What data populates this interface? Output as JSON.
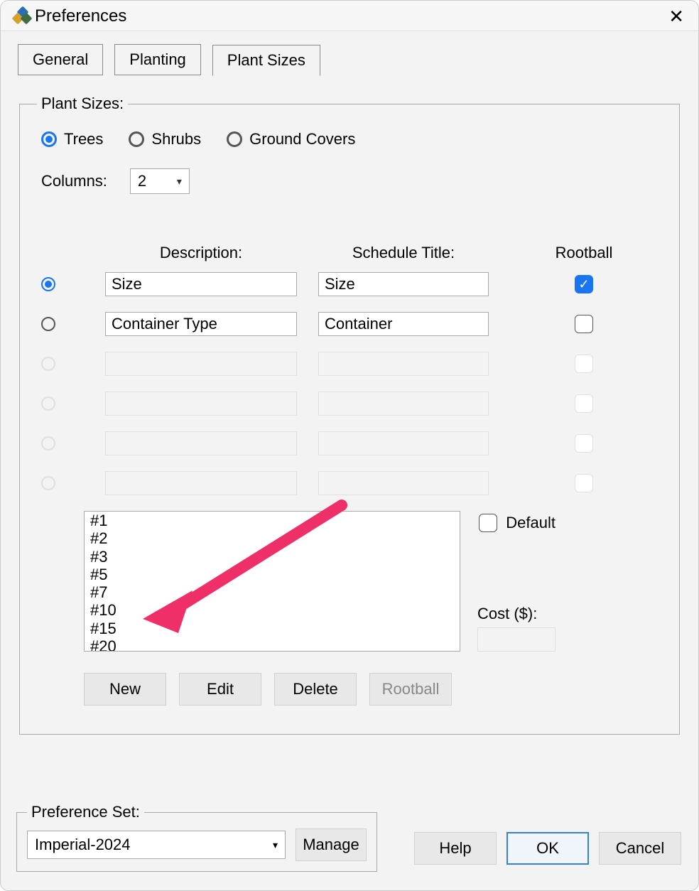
{
  "window": {
    "title": "Preferences"
  },
  "tabs": {
    "general": "General",
    "planting": "Planting",
    "plant_sizes": "Plant Sizes"
  },
  "plant_sizes": {
    "legend": "Plant Sizes:",
    "categories": {
      "trees": "Trees",
      "shrubs": "Shrubs",
      "ground_covers": "Ground Covers"
    },
    "columns_label": "Columns:",
    "columns_value": "2",
    "headers": {
      "description": "Description:",
      "schedule_title": "Schedule Title:",
      "rootball": "Rootball"
    },
    "rows": [
      {
        "description": "Size",
        "schedule": "Size",
        "rootball_checked": true,
        "enabled": true,
        "selected": true
      },
      {
        "description": "Container Type",
        "schedule": "Container",
        "rootball_checked": false,
        "enabled": true,
        "selected": false
      },
      {
        "description": "",
        "schedule": "",
        "rootball_checked": false,
        "enabled": false,
        "selected": false
      },
      {
        "description": "",
        "schedule": "",
        "rootball_checked": false,
        "enabled": false,
        "selected": false
      },
      {
        "description": "",
        "schedule": "",
        "rootball_checked": false,
        "enabled": false,
        "selected": false
      },
      {
        "description": "",
        "schedule": "",
        "rootball_checked": false,
        "enabled": false,
        "selected": false
      }
    ],
    "sizes": [
      "#1",
      "#2",
      "#3",
      "#5",
      "#7",
      "#10",
      "#15",
      "#20"
    ],
    "default_label": "Default",
    "cost_label": "Cost ($):",
    "actions": {
      "new": "New",
      "edit": "Edit",
      "delete": "Delete",
      "rootball": "Rootball"
    }
  },
  "pref_set": {
    "legend": "Preference Set:",
    "value": "Imperial-2024",
    "manage": "Manage"
  },
  "buttons": {
    "help": "Help",
    "ok": "OK",
    "cancel": "Cancel"
  }
}
